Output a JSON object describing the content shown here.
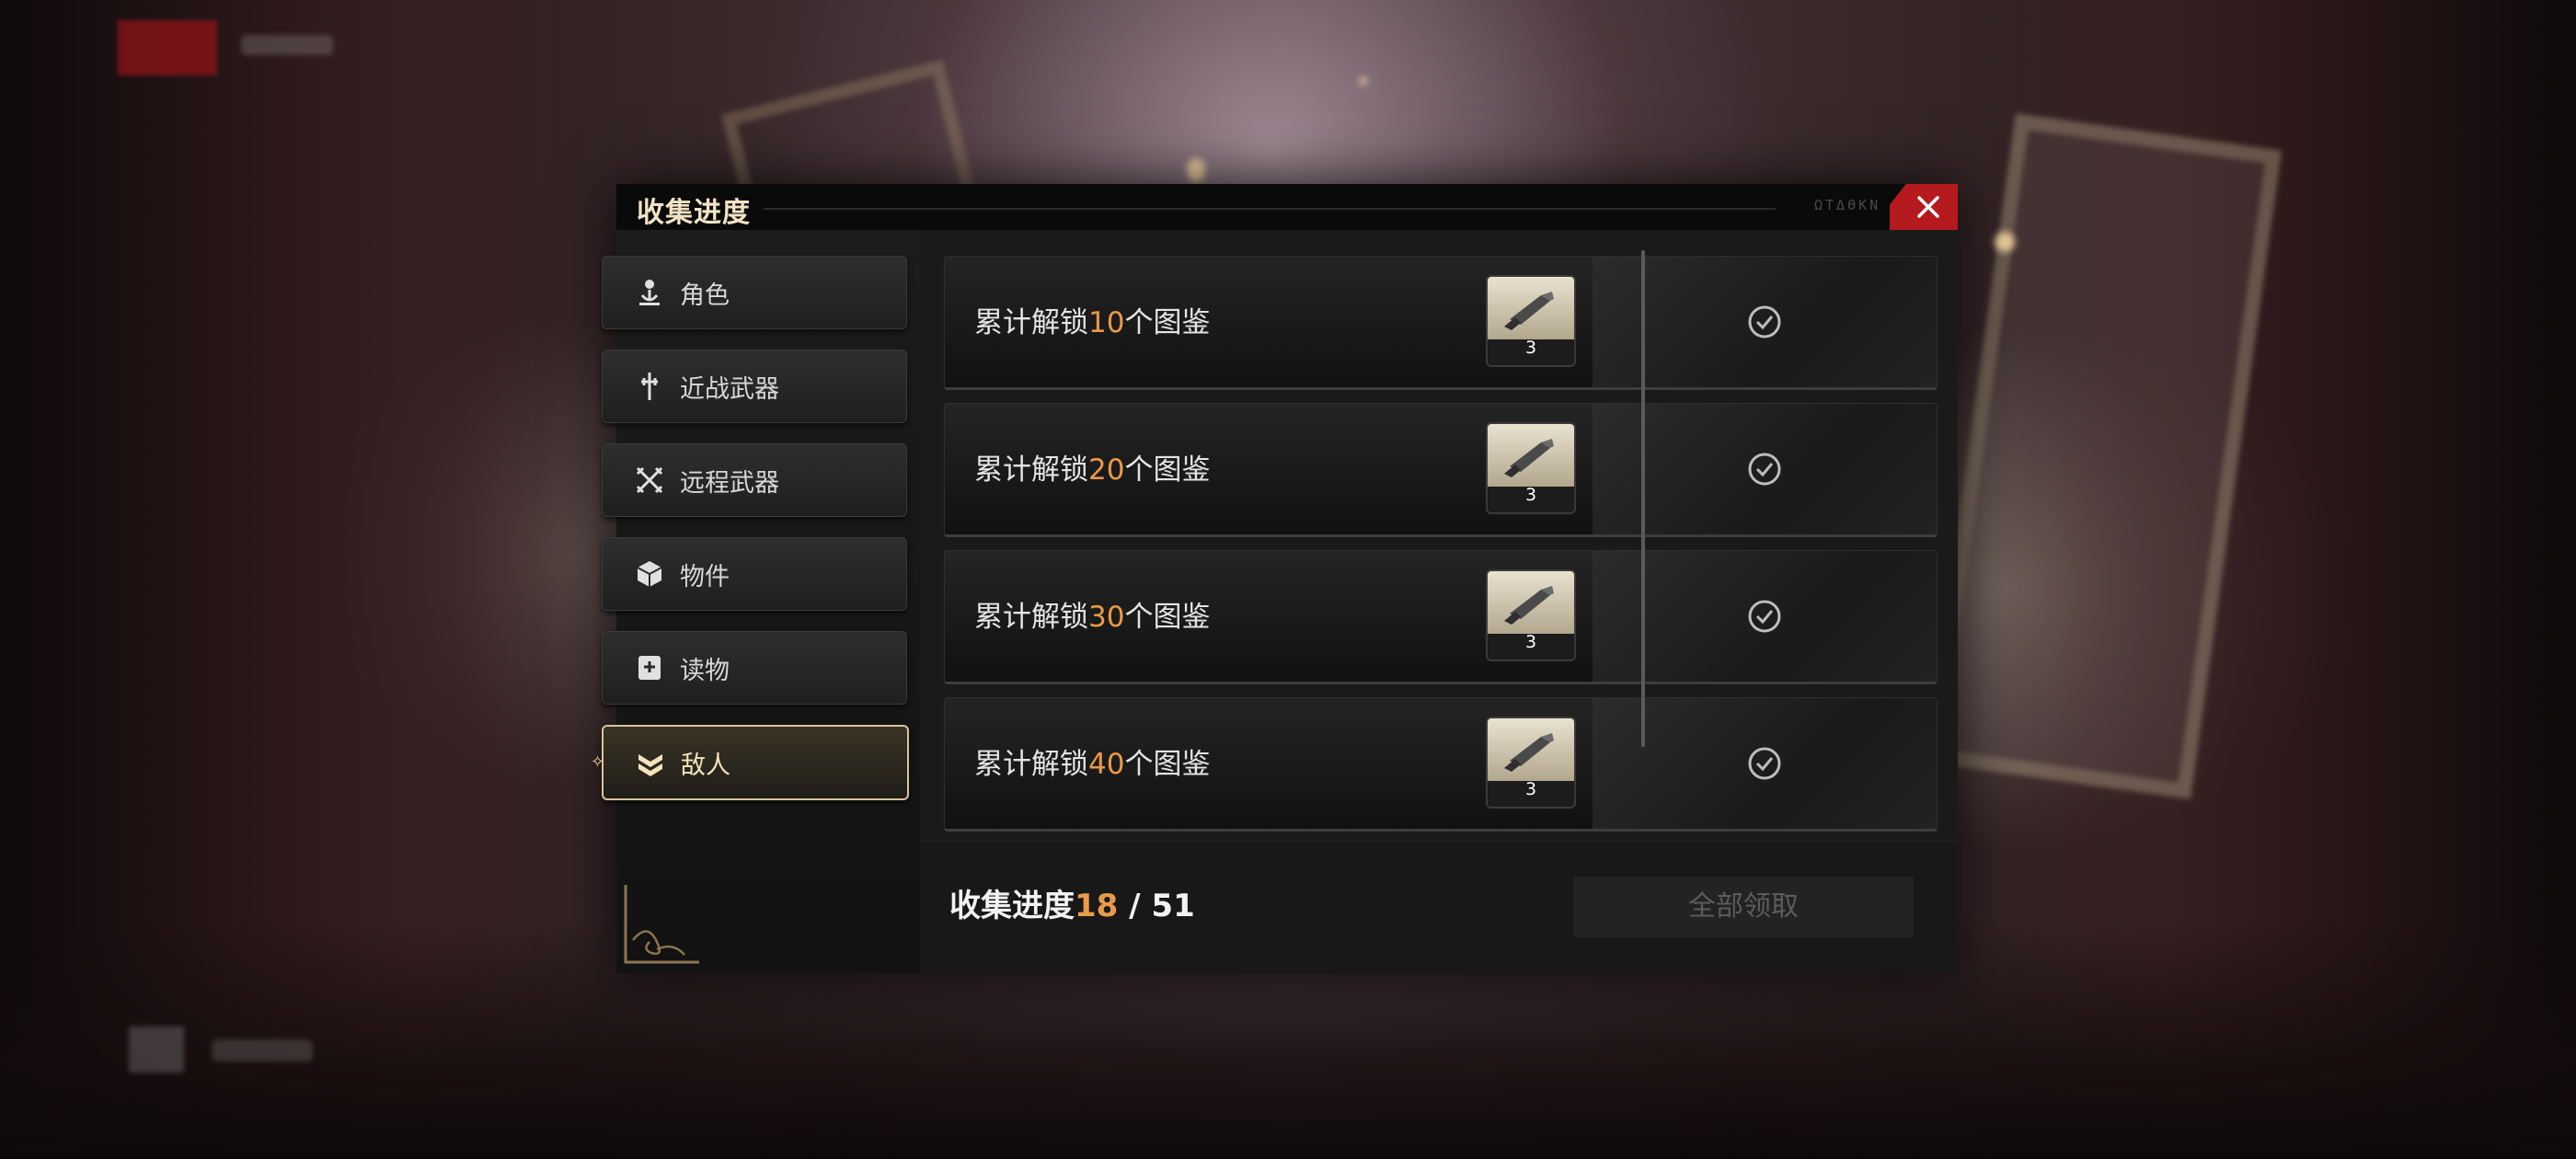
{
  "dialog": {
    "title": "收集进度",
    "title_code": "ΩΤΔΘΚΝ"
  },
  "sidebar": {
    "items": [
      {
        "label": "角色",
        "icon": "character-icon",
        "active": false
      },
      {
        "label": "近战武器",
        "icon": "melee-weapon-icon",
        "active": false
      },
      {
        "label": "远程武器",
        "icon": "ranged-weapon-icon",
        "active": false
      },
      {
        "label": "物件",
        "icon": "item-cube-icon",
        "active": false
      },
      {
        "label": "读物",
        "icon": "book-icon",
        "active": false
      },
      {
        "label": "敌人",
        "icon": "enemy-chevron-icon",
        "active": true
      }
    ]
  },
  "milestones": [
    {
      "prefix": "累计解锁",
      "count": "10",
      "suffix": "个图鉴",
      "reward_qty": "3",
      "status": "claimed"
    },
    {
      "prefix": "累计解锁",
      "count": "20",
      "suffix": "个图鉴",
      "reward_qty": "3",
      "status": "claimed"
    },
    {
      "prefix": "累计解锁",
      "count": "30",
      "suffix": "个图鉴",
      "reward_qty": "3",
      "status": "claimed"
    },
    {
      "prefix": "累计解锁",
      "count": "40",
      "suffix": "个图鉴",
      "reward_qty": "3",
      "status": "claimed"
    }
  ],
  "footer": {
    "progress_label": "收集进度",
    "progress_current": "18",
    "progress_separator": " / ",
    "progress_total": "51",
    "claim_all_label": "全部领取"
  },
  "colors": {
    "accent_orange": "#e99a48",
    "close_red": "#b41a1e",
    "active_gold": "#d8c49b"
  }
}
